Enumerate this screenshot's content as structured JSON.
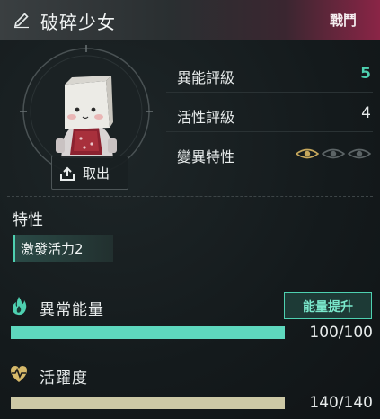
{
  "header": {
    "title": "破碎少女",
    "badge": "戰鬥",
    "edit_icon": "pencil-icon"
  },
  "portrait": {
    "take_out_label": "取出",
    "take_out_icon": "upload-icon"
  },
  "stats": {
    "ability_rating_label": "異能評級",
    "ability_rating_value": "5",
    "activity_rating_label": "活性評級",
    "activity_rating_value": "4",
    "mutation_label": "變異特性",
    "mutation_icons": [
      "eye-icon",
      "eye-icon",
      "eye-icon"
    ],
    "mutation_level": 1,
    "mutation_max": 3
  },
  "traits": {
    "title": "特性",
    "items": [
      "激發活力2"
    ]
  },
  "energy": {
    "label": "異常能量",
    "icon": "flame-icon",
    "boost_label": "能量提升",
    "value_text": "100/100",
    "current": 100,
    "max": 100,
    "color": "#5ed8be"
  },
  "vitality": {
    "label": "活躍度",
    "icon": "heart-pulse-icon",
    "value_text": "140/140",
    "current": 140,
    "max": 140,
    "color": "#cdc9a6"
  },
  "colors": {
    "accent": "#4ed0b0",
    "badge": "#8a2546",
    "gold": "#c7a85c"
  }
}
